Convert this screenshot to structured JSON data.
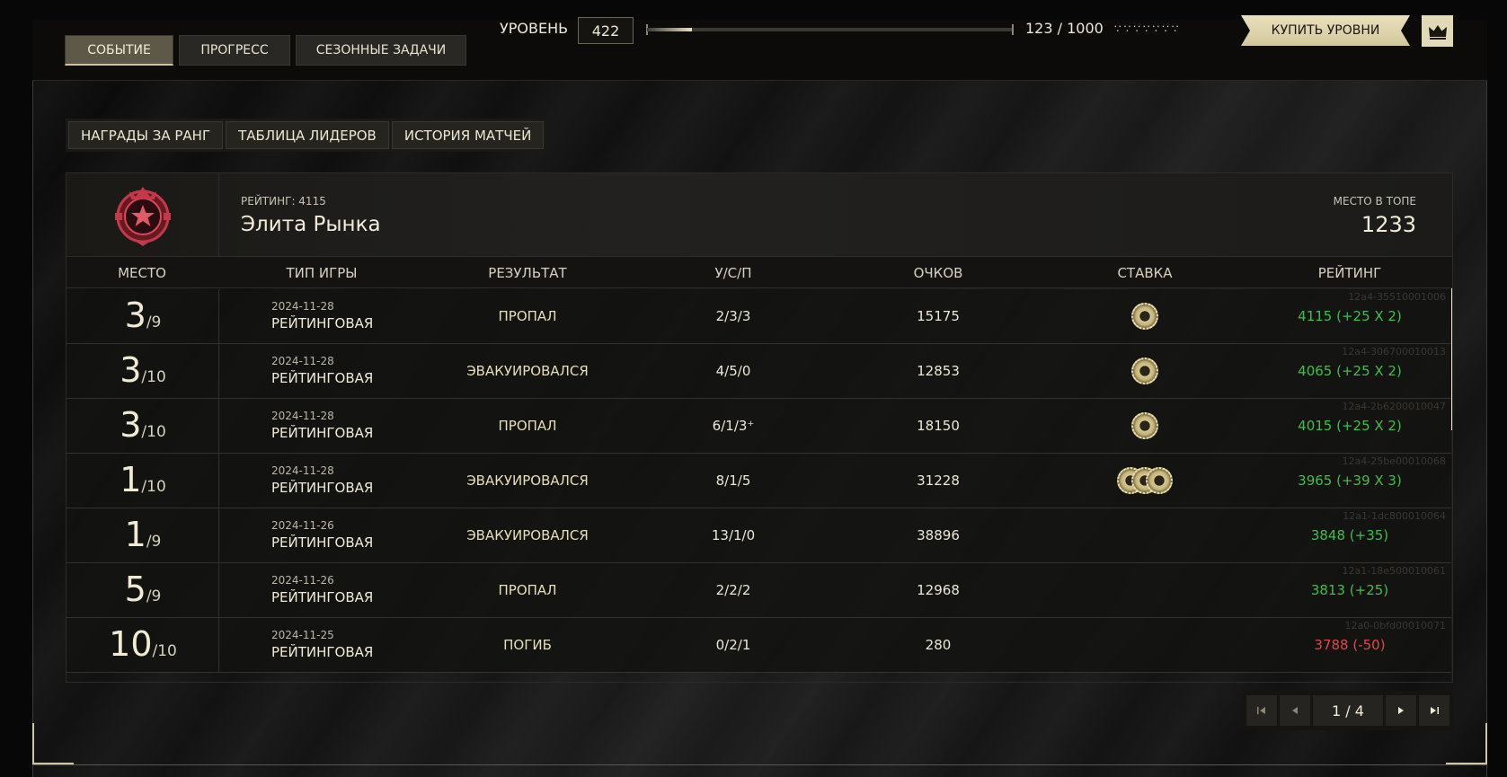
{
  "top_tabs": [
    {
      "label": "СОБЫТИЕ",
      "active": true
    },
    {
      "label": "ПРОГРЕСС",
      "active": false
    },
    {
      "label": "СЕЗОННЫЕ ЗАДАЧИ",
      "active": false
    }
  ],
  "level": {
    "label": "УРОВЕНЬ",
    "value": "422",
    "progress_text": "123 / 1000",
    "progress_fraction": 0.123,
    "dots": "∵∵∵∵∵∵∵"
  },
  "buy_levels_label": "КУПИТЬ УРОВНИ",
  "sub_tabs": [
    "НАГРАДЫ ЗА РАНГ",
    "ТАБЛИЦА ЛИДЕРОВ",
    "ИСТОРИЯ МАТЧЕЙ"
  ],
  "rank": {
    "rating_label": "РЕЙТИНГ: 4115",
    "name": "Элита Рынка",
    "top_label": "МЕСТО В ТОПЕ",
    "top_value": "1233"
  },
  "columns": [
    "МЕСТО",
    "ТИП ИГРЫ",
    "РЕЗУЛЬТАТ",
    "У/С/П",
    "ОЧКОВ",
    "СТАВКА",
    "РЕЙТИНГ"
  ],
  "matches": [
    {
      "place": "3",
      "of": "/9",
      "date": "2024-11-28",
      "type": "РЕЙТИНГОВАЯ",
      "result": "ПРОПАЛ",
      "usp": "2/3/3",
      "score": "15175",
      "chips": 1,
      "rating": "4115 (+25 X 2)",
      "rating_sign": "pos",
      "id": "12a4-35510001006"
    },
    {
      "place": "3",
      "of": "/10",
      "date": "2024-11-28",
      "type": "РЕЙТИНГОВАЯ",
      "result": "ЭВАКУИРОВАЛСЯ",
      "usp": "4/5/0",
      "score": "12853",
      "chips": 1,
      "rating": "4065 (+25 X 2)",
      "rating_sign": "pos",
      "id": "12a4-306700010013"
    },
    {
      "place": "3",
      "of": "/10",
      "date": "2024-11-28",
      "type": "РЕЙТИНГОВАЯ",
      "result": "ПРОПАЛ",
      "usp": "6/1/3⁺",
      "score": "18150",
      "chips": 1,
      "rating": "4015 (+25 X 2)",
      "rating_sign": "pos",
      "id": "12a4-2b6200010047"
    },
    {
      "place": "1",
      "of": "/10",
      "date": "2024-11-28",
      "type": "РЕЙТИНГОВАЯ",
      "result": "ЭВАКУИРОВАЛСЯ",
      "usp": "8/1/5",
      "score": "31228",
      "chips": 3,
      "rating": "3965 (+39 X 3)",
      "rating_sign": "pos",
      "id": "12a4-25be00010068"
    },
    {
      "place": "1",
      "of": "/9",
      "date": "2024-11-26",
      "type": "РЕЙТИНГОВАЯ",
      "result": "ЭВАКУИРОВАЛСЯ",
      "usp": "13/1/0",
      "score": "38896",
      "chips": 0,
      "rating": "3848 (+35)",
      "rating_sign": "pos",
      "id": "12a1-1dc800010064"
    },
    {
      "place": "5",
      "of": "/9",
      "date": "2024-11-26",
      "type": "РЕЙТИНГОВАЯ",
      "result": "ПРОПАЛ",
      "usp": "2/2/2",
      "score": "12968",
      "chips": 0,
      "rating": "3813 (+25)",
      "rating_sign": "pos",
      "id": "12a1-18e500010061"
    },
    {
      "place": "10",
      "of": "/10",
      "date": "2024-11-25",
      "type": "РЕЙТИНГОВАЯ",
      "result": "ПОГИБ",
      "usp": "0/2/1",
      "score": "280",
      "chips": 0,
      "rating": "3788 (-50)",
      "rating_sign": "neg",
      "id": "12a0-0bfd00010071"
    }
  ],
  "pagination": {
    "text": "1 / 4"
  },
  "colors": {
    "positive": "#3fbf4a",
    "negative": "#e0474a",
    "accent": "#e9e0bd"
  }
}
